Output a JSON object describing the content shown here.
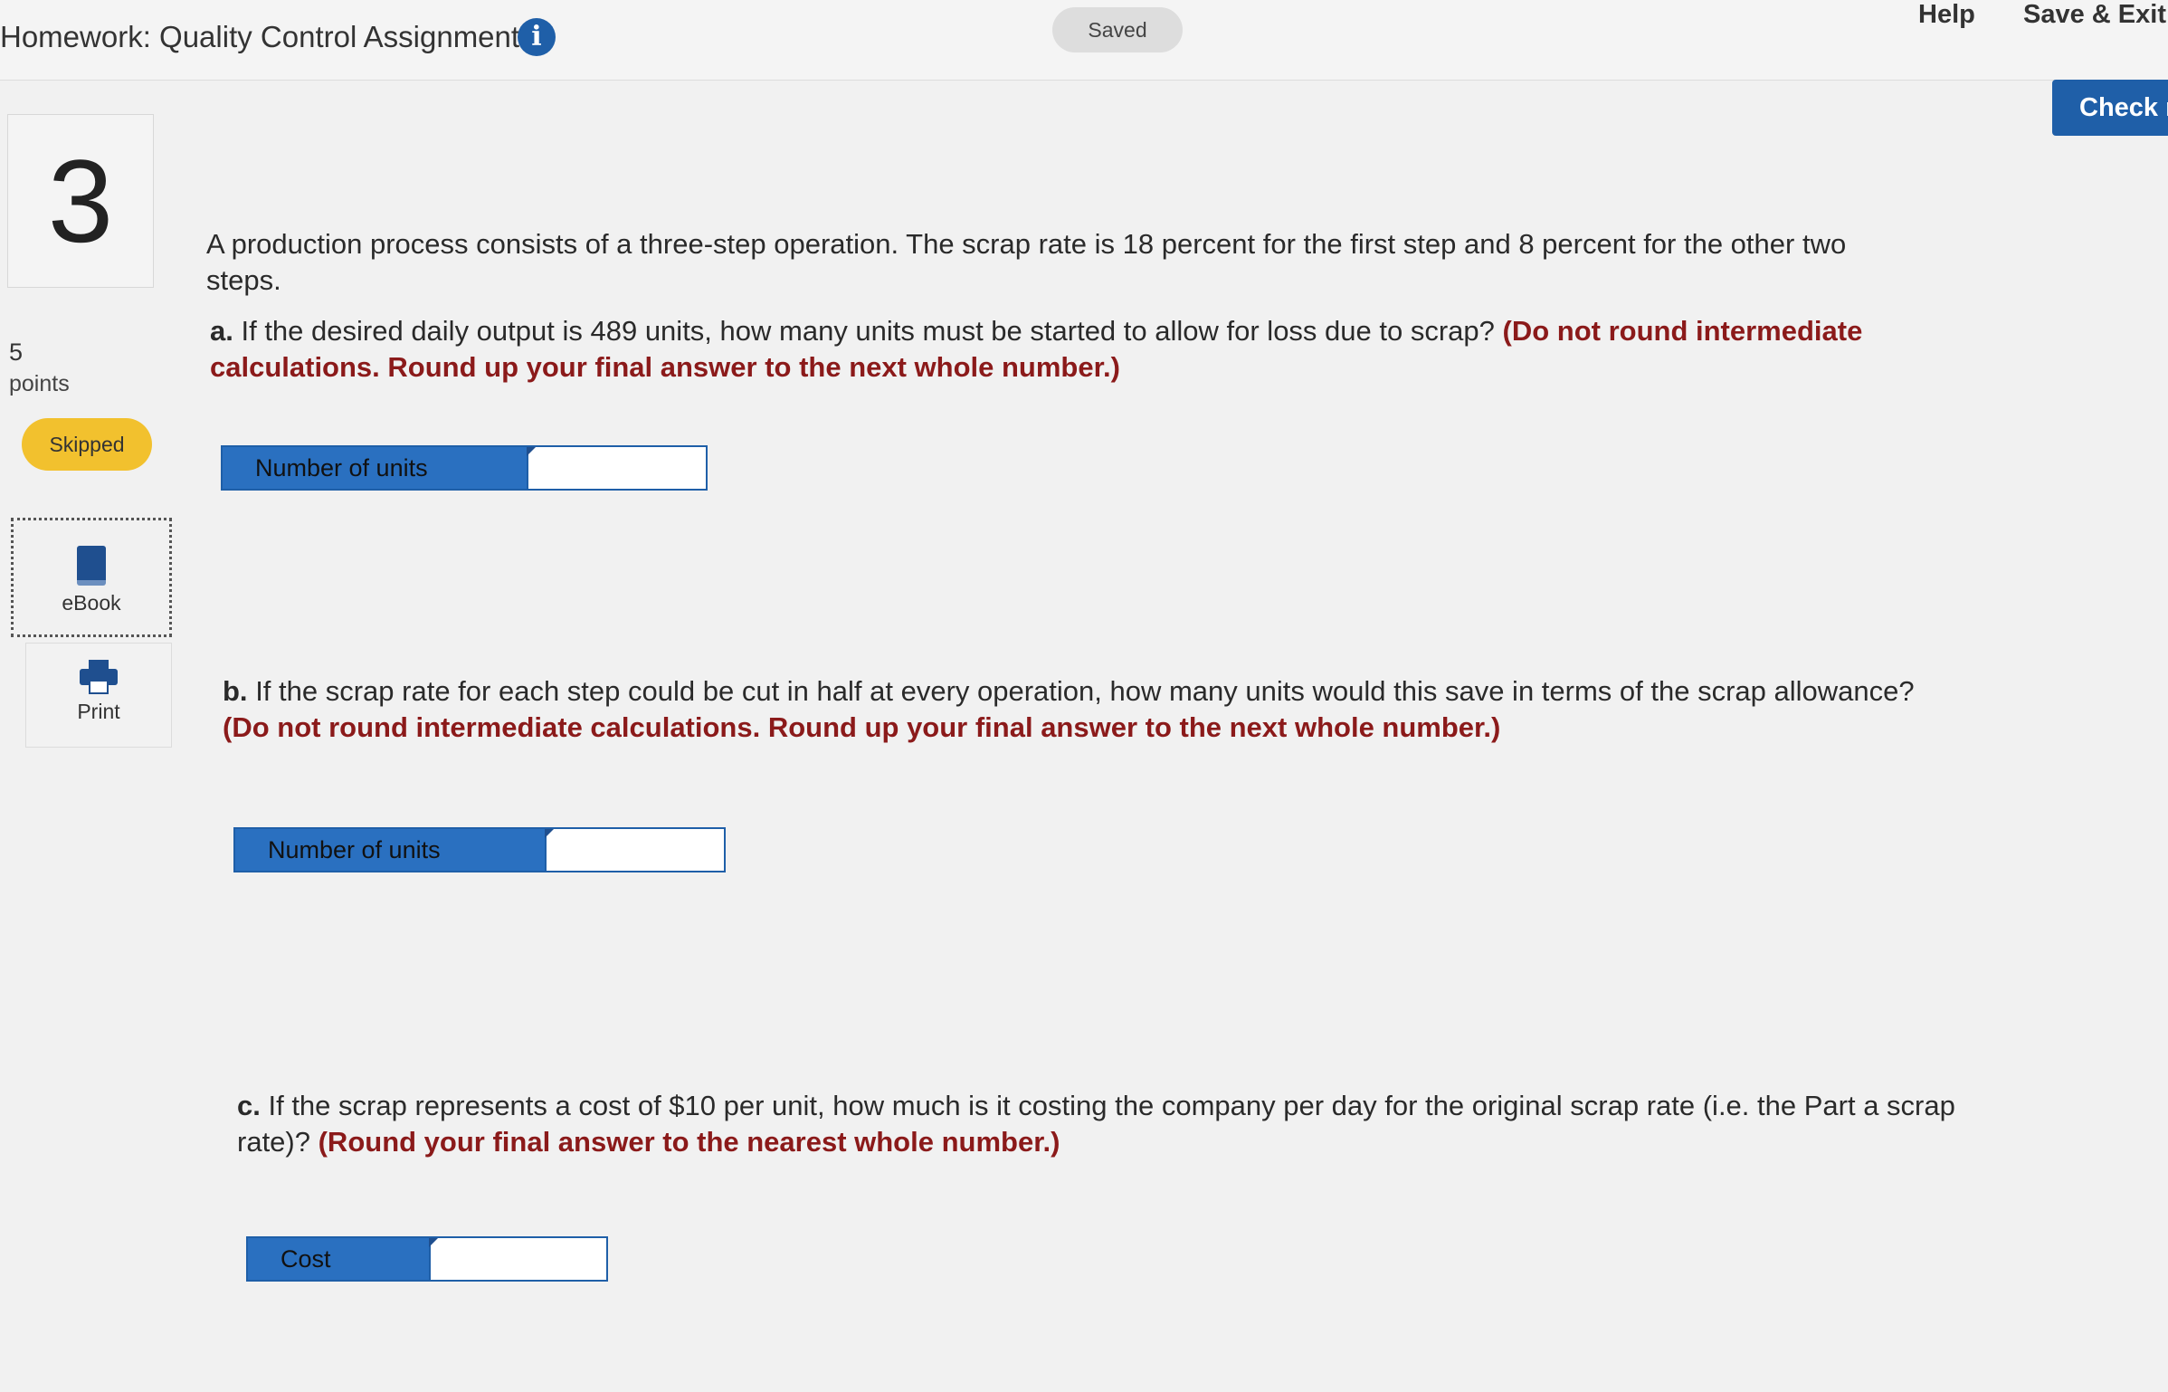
{
  "header": {
    "title": "Homework: Quality Control Assignment",
    "saved_status": "Saved",
    "help_label": "Help",
    "save_exit_label": "Save & Exit",
    "check_label": "Check r"
  },
  "sidebar": {
    "question_number": "3",
    "points_value": "5",
    "points_label": "points",
    "status_badge": "Skipped",
    "ebook_label": "eBook",
    "print_label": "Print"
  },
  "question": {
    "problem": "A production process consists of a three-step operation. The scrap rate is 18 percent for the first step and 8 percent for the other two steps.",
    "parts": [
      {
        "letter": "a.",
        "text": "If the desired daily output is 489 units, how many units must be started to allow for loss due to scrap?",
        "instruction": "(Do not round intermediate calculations. Round up your final answer to the next whole number.)",
        "answer_label": "Number of units",
        "answer_value": ""
      },
      {
        "letter": "b.",
        "text": "If the scrap rate for each step could be cut in half at every operation, how many units would this save in terms of the scrap allowance?",
        "instruction": "(Do not round intermediate calculations. Round up your final answer to the next whole number.)",
        "answer_label": "Number of units",
        "answer_value": ""
      },
      {
        "letter": "c.",
        "text": "If the scrap represents a cost of $10 per unit, how much is it costing the company per day for the original scrap rate (i.e. the Part a scrap rate)?",
        "instruction": "(Round your final answer to the nearest whole number.)",
        "answer_label": "Cost",
        "answer_value": ""
      }
    ]
  },
  "colors": {
    "accent": "#1f5fa8",
    "instruction_red": "#8b1a1a",
    "skipped_yellow": "#f2c12e"
  },
  "icons": [
    "info-icon",
    "book-icon",
    "printer-icon"
  ]
}
